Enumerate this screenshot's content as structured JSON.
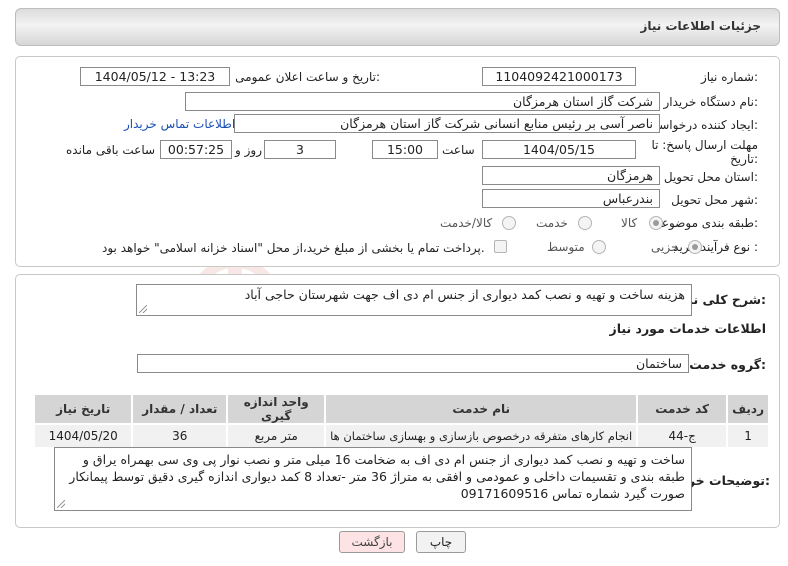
{
  "header": {
    "title": "جزئیات اطلاعات نیاز"
  },
  "fields": {
    "need_number": {
      "label": "شماره نیاز:",
      "value": "1104092421000173"
    },
    "announce": {
      "label": "تاریخ و ساعت اعلان عمومی:",
      "value": "1404/05/12 - 13:23"
    },
    "buyer_org": {
      "label": "نام دستگاه خریدار:",
      "value": "شرکت گاز استان هرمزگان"
    },
    "creator": {
      "label": "ایجاد کننده درخواست:",
      "value": "ناصر آسی بر رئیس منابع انسانی شرکت گاز استان هرمزگان",
      "link": "اطلاعات تماس خریدار"
    },
    "deadline": {
      "label_line1": "مهلت ارسال پاسخ: تا",
      "label_line2": "تاریخ:",
      "date": "1404/05/15",
      "time_label": "ساعت",
      "time": "15:00",
      "days": "3",
      "days_label": "روز و",
      "remaining": "00:57:25",
      "remaining_label": "ساعت باقی مانده"
    },
    "province": {
      "label": "استان محل تحویل:",
      "value": "هرمزگان"
    },
    "city": {
      "label": "شهر محل تحویل:",
      "value": "بندرعباس"
    },
    "category": {
      "label": "طبقه بندی موضوعی:",
      "options": [
        "کالا",
        "خدمت",
        "کالا/خدمت"
      ]
    },
    "process": {
      "label": "نوع فرآیند خرید :",
      "options": [
        "جزیی",
        "متوسط"
      ],
      "payment_note": "پرداخت تمام یا بخشی از مبلغ خرید،از محل \"اسناد خزانه اسلامی\" خواهد بود."
    }
  },
  "summary": {
    "label": "شرح کلی نیاز:",
    "value": "هزینه ساخت و تهیه و نصب کمد دیواری از جنس ام دی اف جهت شهرستان حاجی آباد"
  },
  "services": {
    "section_title": "اطلاعات خدمات مورد نیاز",
    "group_label": "گروه خدمت:",
    "group_value": "ساختمان",
    "columns": [
      "ردیف",
      "کد خدمت",
      "نام خدمت",
      "واحد اندازه گیری",
      "تعداد / مقدار",
      "تاریخ نیاز"
    ],
    "rows": [
      {
        "row": "1",
        "code": "ج-44",
        "name": "انجام کارهای متفرقه درخصوص بازسازی و بهسازی ساختمان ها",
        "unit": "متر مربع",
        "qty": "36",
        "date": "1404/05/20"
      }
    ]
  },
  "buyer_notes": {
    "label": "توضیحات خریدار:",
    "value": "ساخت و تهیه و نصب کمد دیواری از جنس ام دی اف به ضخامت 16 میلی متر و نصب نوار پی وی سی  بهمراه یراق و طبقه بندی و تقسیمات داخلی و عمودمی و افقی به متراژ 36 متر -تعداد 8 کمد دیواری اندازه گیری دقیق توسط پیمانکار صورت گیرد شماره تماس 09171609516"
  },
  "buttons": {
    "print": "چاپ",
    "back": "بازگشت"
  },
  "watermark_text": "AriaTender.neT",
  "colors": {
    "link": "#1a4fb5",
    "back_button": "#fde3e3",
    "table_header": "#d5d5d5"
  }
}
